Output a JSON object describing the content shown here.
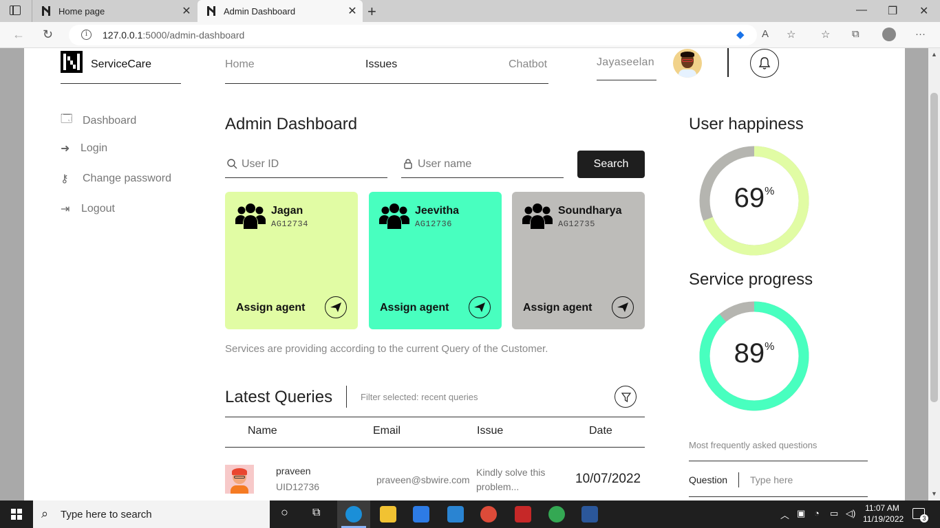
{
  "browser": {
    "tabs": [
      {
        "label": "Home page"
      },
      {
        "label": "Admin Dashboard"
      }
    ],
    "url_host": "127.0.0.1",
    "url_path": ":5000/admin-dashboard"
  },
  "header": {
    "brand": "ServiceCare",
    "nav": [
      {
        "label": "Home",
        "color": "#888888"
      },
      {
        "label": "Issues",
        "color": "#222222"
      },
      {
        "label": "Chatbot",
        "color": "#888888"
      }
    ],
    "user_name": "Jayaseelan"
  },
  "sidebar": {
    "items": [
      {
        "label": "Dashboard",
        "icon": "window-icon"
      },
      {
        "label": "Login",
        "icon": "login-arrow-icon"
      },
      {
        "label": "Change password",
        "icon": "key-icon"
      },
      {
        "label": "Logout",
        "icon": "logout-icon"
      }
    ]
  },
  "main": {
    "title": "Admin Dashboard",
    "search": {
      "user_id_placeholder": "User ID",
      "user_name_placeholder": "User name",
      "button": "Search"
    },
    "cards": [
      {
        "name": "Jagan",
        "id": "AG12734",
        "action": "Assign agent",
        "color": "#e1fca4"
      },
      {
        "name": "Jeevitha",
        "id": "AG12736",
        "action": "Assign agent",
        "color": "#48ffbf"
      },
      {
        "name": "Soundharya",
        "id": "AG12735",
        "action": "Assign agent",
        "color": "#bdbcb9"
      }
    ],
    "note": "Services are providing according to the current Query of the Customer.",
    "queries": {
      "title": "Latest Queries",
      "filter_text": "Filter selected: recent queries",
      "columns": [
        "Name",
        "Email",
        "Issue",
        "Date"
      ],
      "rows": [
        {
          "name": "praveen",
          "uid": "UID12736",
          "email": "praveen@sbwire.com",
          "issue_line1": "Kindly solve this",
          "issue_line2": "problem...",
          "date": "10/07/2022"
        }
      ]
    }
  },
  "right": {
    "happiness": {
      "title": "User happiness",
      "value": 69,
      "unit": "%",
      "color": "#e1fca4",
      "track": "#b5b5b0"
    },
    "progress": {
      "title": "Service progress",
      "value": 89,
      "unit": "%",
      "color": "#48ffbf",
      "track": "#b5b5b0"
    },
    "faq": {
      "label": "Most frequently asked questions",
      "question_label": "Question",
      "placeholder": "Type here"
    }
  },
  "taskbar": {
    "search_placeholder": "Type here to search",
    "time": "11:07 AM",
    "date": "11/19/2022",
    "notifications": "3"
  }
}
